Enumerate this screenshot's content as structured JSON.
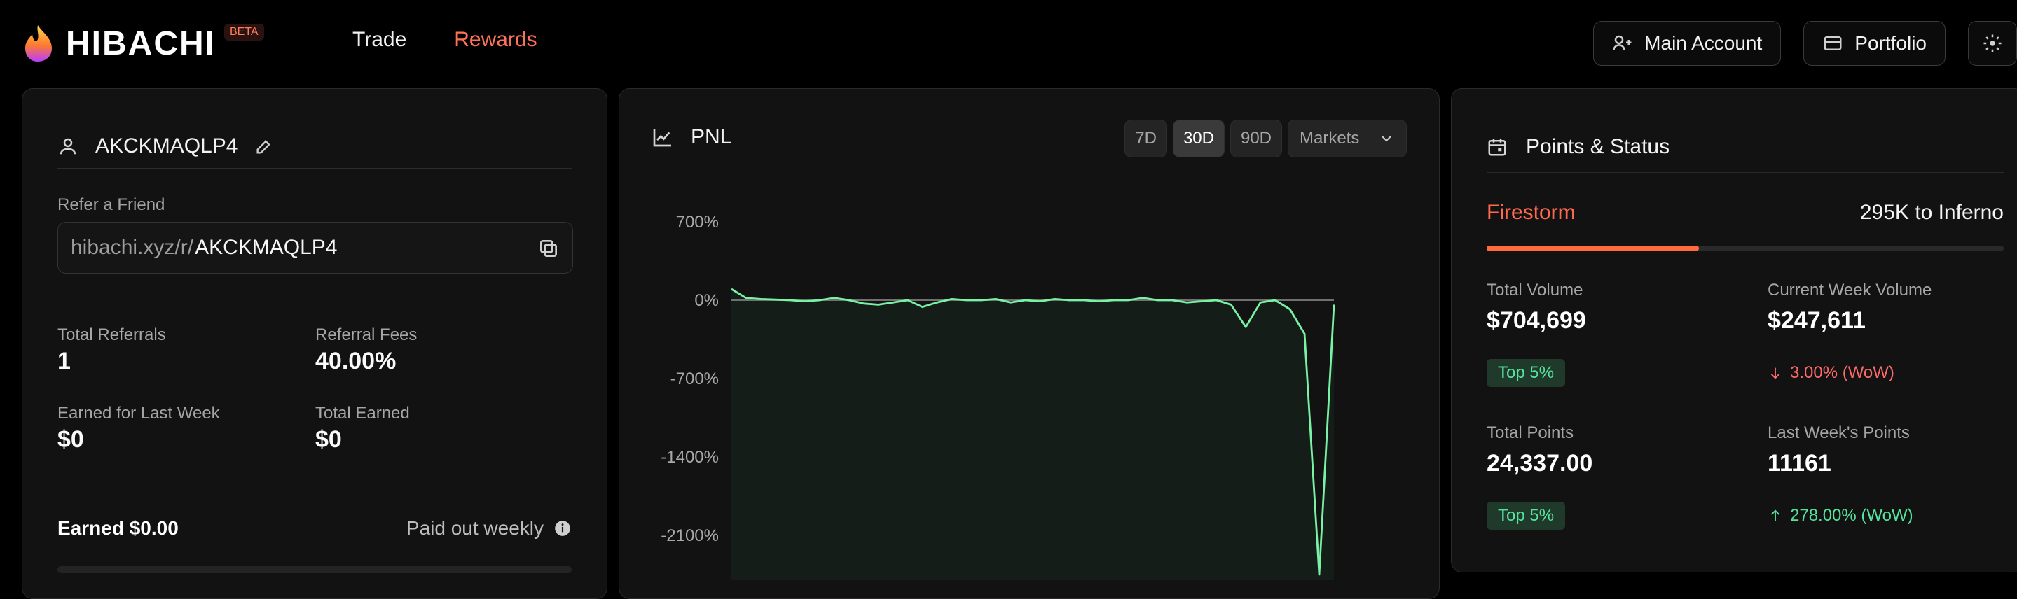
{
  "header": {
    "brand": "HIBACHI",
    "badge": "BETA",
    "nav": [
      {
        "label": "Trade"
      },
      {
        "label": "Rewards"
      }
    ],
    "buttons": {
      "main_account": "Main Account",
      "portfolio": "Portfolio"
    }
  },
  "profile": {
    "username": "AKCKMAQLP4",
    "refer_label": "Refer a Friend",
    "ref_prefix": "hibachi.xyz/r/",
    "ref_code": "AKCKMAQLP4"
  },
  "referral_stats": {
    "total_referrals_label": "Total Referrals",
    "total_referrals_value": "1",
    "referral_fees_label": "Referral Fees",
    "referral_fees_value": "40.00%",
    "earned_last_week_label": "Earned for Last Week",
    "earned_last_week_value": "$0",
    "total_earned_label": "Total Earned",
    "total_earned_value": "$0",
    "earned_summary": "Earned $0.00",
    "paid_out": "Paid out weekly"
  },
  "pnl": {
    "title": "PNL",
    "ranges": [
      "7D",
      "30D",
      "90D"
    ],
    "active_range": "30D",
    "markets_label": "Markets"
  },
  "chart_data": {
    "type": "line",
    "title": "",
    "xlabel": "",
    "ylabel": "",
    "y_ticks": [
      "700%",
      "0%",
      "-700%",
      "-1400%",
      "-2100%"
    ],
    "ylim": [
      -2500,
      900
    ],
    "series": [
      {
        "values": [
          100,
          20,
          10,
          5,
          0,
          -10,
          0,
          20,
          0,
          -30,
          -40,
          -20,
          0,
          -60,
          -20,
          10,
          0,
          0,
          10,
          -20,
          0,
          -10,
          10,
          0,
          0,
          -10,
          0,
          0,
          20,
          0,
          0,
          -20,
          -10,
          0,
          -40,
          -240,
          -20,
          0,
          -80,
          -300,
          -2450,
          -40
        ]
      }
    ],
    "baseline": 0,
    "grid": false
  },
  "points": {
    "title": "Points & Status",
    "current_tier": "Firestorm",
    "next_tier_text": "295K to Inferno",
    "tier_progress": 0.41,
    "total_volume_label": "Total Volume",
    "total_volume_value": "$704,699",
    "current_week_volume_label": "Current Week Volume",
    "current_week_volume_value": "$247,611",
    "volume_rank": "Top 5%",
    "volume_change": "3.00% (WoW)",
    "total_points_label": "Total Points",
    "total_points_value": "24,337.00",
    "last_week_points_label": "Last Week's Points",
    "last_week_points_value": "11161",
    "points_rank": "Top 5%",
    "points_change": "278.00% (WoW)"
  },
  "colors": {
    "accent": "#ff6a4f",
    "positive": "#54e39c",
    "negative": "#ff6a6a",
    "chart_line": "#79f2a5"
  }
}
